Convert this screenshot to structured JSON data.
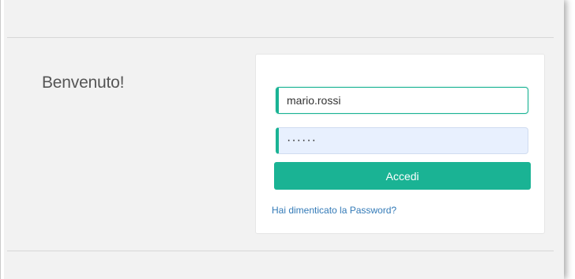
{
  "header": {
    "welcome_text": "Benvenuto!"
  },
  "login_form": {
    "username_value": "mario.rossi",
    "password_value": "······",
    "submit_label": "Accedi",
    "forgot_password_link": "Hai dimenticato la Password?"
  },
  "colors": {
    "accent": "#1ab394",
    "link": "#337ab7",
    "background": "#f2f2f2",
    "autofill": "#e8f0fe"
  }
}
